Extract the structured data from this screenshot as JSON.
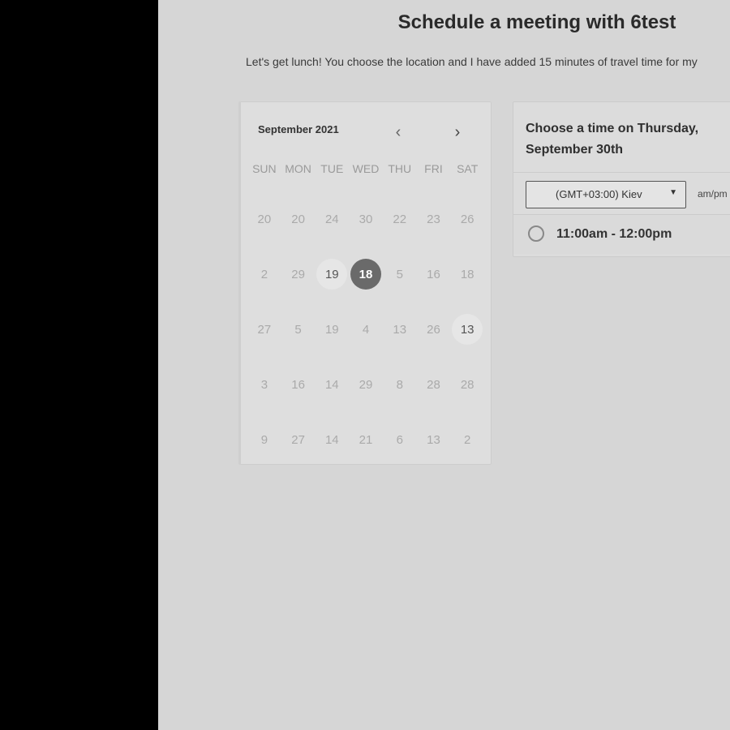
{
  "page": {
    "title": "Schedule a meeting with 6test",
    "subtitle": "Let's get lunch! You choose the location and I have added 15 minutes of travel time for my"
  },
  "calendar": {
    "month_label": "September 2021",
    "prev_icon": "chevron-left-icon",
    "next_icon": "chevron-right-icon",
    "weekdays": [
      "SUN",
      "MON",
      "TUE",
      "WED",
      "THU",
      "FRI",
      "SAT"
    ],
    "weeks": [
      [
        "20",
        "20",
        "24",
        "30",
        "22",
        "23",
        "26"
      ],
      [
        "2",
        "29",
        "19",
        "18",
        "5",
        "16",
        "18"
      ],
      [
        "27",
        "5",
        "19",
        "4",
        "13",
        "26",
        "13"
      ],
      [
        "3",
        "16",
        "14",
        "29",
        "8",
        "28",
        "28"
      ],
      [
        "9",
        "27",
        "14",
        "21",
        "6",
        "13",
        "2"
      ]
    ],
    "available": [
      [
        1,
        2
      ],
      [
        2,
        6
      ]
    ],
    "selected": [
      1,
      3
    ]
  },
  "panel": {
    "title": "Choose a time on Thursday, September 30th",
    "timezone": "(GMT+03:00) Kiev",
    "ampm_label": "am/pm",
    "slots": [
      {
        "label": "11:00am - 12:00pm"
      }
    ]
  },
  "colors": {
    "background": "#d6d6d6",
    "selected_day": "#6a6a6a",
    "side_panel": "#000000"
  }
}
